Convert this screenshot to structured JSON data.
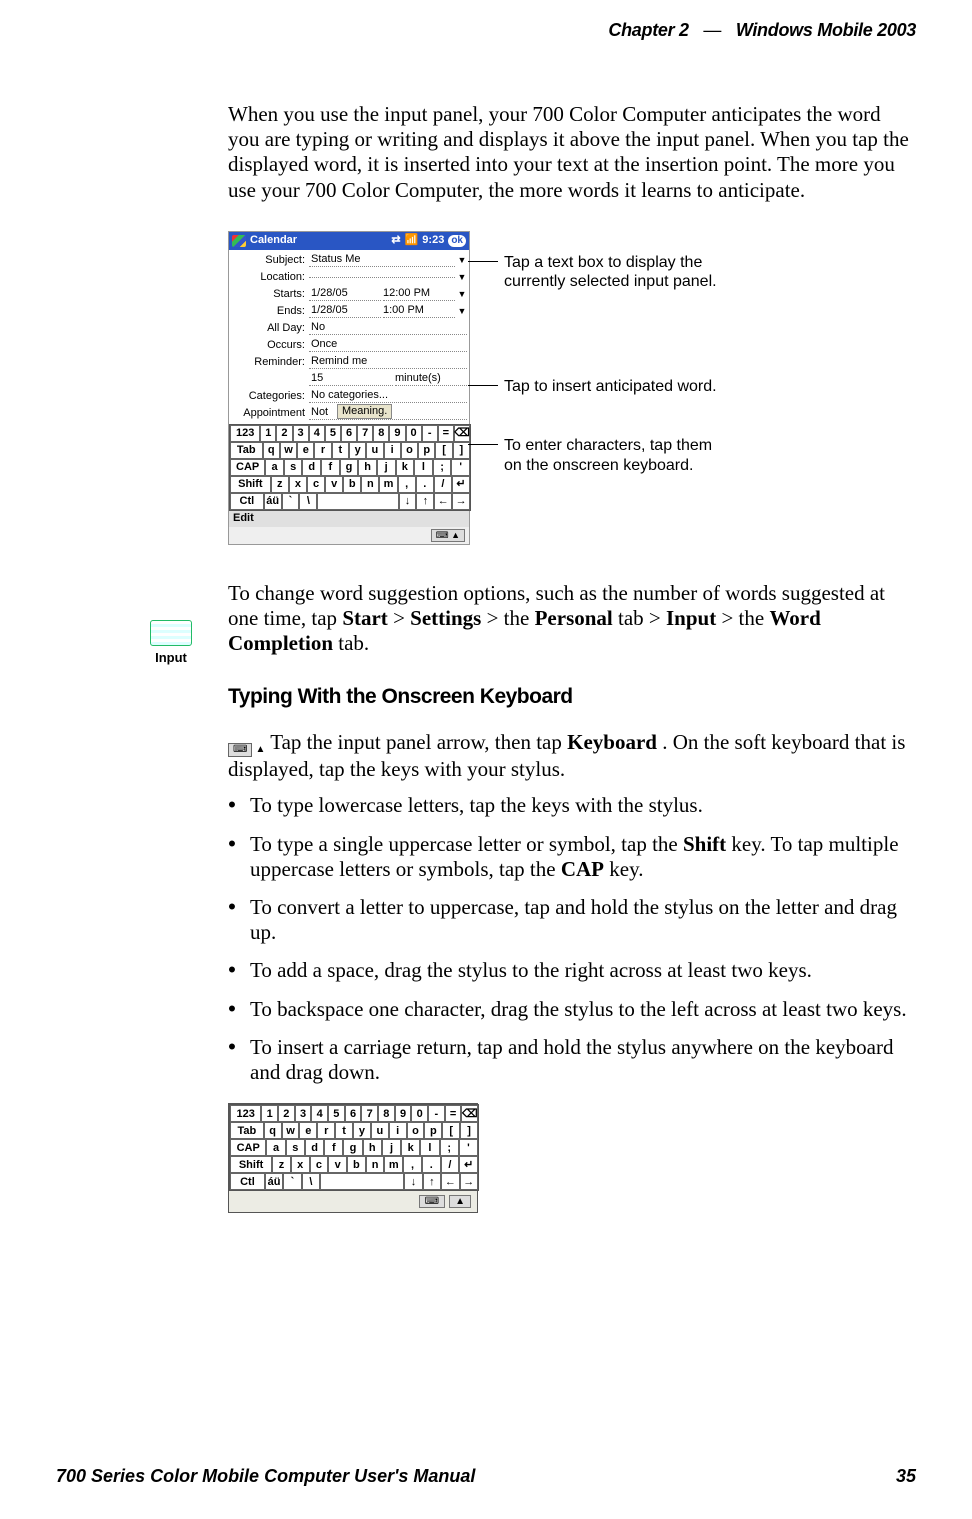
{
  "header": {
    "chapter": "Chapter 2",
    "dash": "—",
    "product": "Windows Mobile 2003"
  },
  "intro_para": "When you use the input panel, your 700 Color Computer anticipates the word you are typing or writing and displays it above the input panel. When you tap the displayed word, it is inserted into your text at the insertion point. The more you use your 700 Color Computer, the more words it learns to anticipate.",
  "shot": {
    "title": "Calendar",
    "time": "9:23",
    "ok": "ok",
    "rows": {
      "subject_lbl": "Subject:",
      "subject_val": "Status Me",
      "location_lbl": "Location:",
      "location_val": "",
      "starts_lbl": "Starts:",
      "starts_d": "1/28/05",
      "starts_t": "12:00 PM",
      "ends_lbl": "Ends:",
      "ends_d": "1/28/05",
      "ends_t": "1:00 PM",
      "allday_lbl": "All Day:",
      "allday_val": "No",
      "occurs_lbl": "Occurs:",
      "occurs_val": "Once",
      "reminder_lbl": "Reminder:",
      "reminder_val": "Remind me",
      "reminder_n": "15",
      "reminder_u": "minute(s)",
      "categories_lbl": "Categories:",
      "categories_val": "No categories...",
      "appointment_lbl": "Appointment",
      "appointment_val": "Not",
      "suggest": "Meaning."
    },
    "edit": "Edit"
  },
  "kb": {
    "r1": [
      "123",
      "1",
      "2",
      "3",
      "4",
      "5",
      "6",
      "7",
      "8",
      "9",
      "0",
      "-",
      "=",
      "⌫"
    ],
    "r2": [
      "Tab",
      "q",
      "w",
      "e",
      "r",
      "t",
      "y",
      "u",
      "i",
      "o",
      "p",
      "[",
      "]"
    ],
    "r3": [
      "CAP",
      "a",
      "s",
      "d",
      "f",
      "g",
      "h",
      "j",
      "k",
      "l",
      ";",
      "'"
    ],
    "r4": [
      "Shift",
      "z",
      "x",
      "c",
      "v",
      "b",
      "n",
      "m",
      ",",
      ".",
      "/",
      "↵"
    ],
    "r5": [
      "Ctl",
      "áü",
      "`",
      "\\",
      "",
      "↓",
      "↑",
      "←",
      "→"
    ]
  },
  "callouts": {
    "c1": "Tap a text box to display the currently selected input panel.",
    "c2": "Tap to insert anticipated word.",
    "c3": "To enter characters, tap them on the onscreen keyboard."
  },
  "input_icon_label": "Input",
  "settings_para": {
    "pre": "To change word suggestion options, such as the number of words suggested at one time, tap ",
    "start": "Start",
    "gt1": " > ",
    "settings": "Settings",
    "gt2": " > the ",
    "personal": "Personal",
    "tabword1": " tab > ",
    "input": "Input",
    "gt3": " > the ",
    "wordcompletion": "Word Completion",
    "tail": " tab."
  },
  "section_title": "Typing With the Onscreen Keyboard",
  "typing_para": {
    "pre": "Tap the input panel arrow, then tap ",
    "kb": "Keyboard",
    "post": ". On the soft keyboard that is displayed, tap the keys with your stylus."
  },
  "bullets": {
    "b1": "To type lowercase letters, tap the keys with the stylus.",
    "b2a": "To type a single uppercase letter or symbol, tap the ",
    "b2_shift": "Shift",
    "b2b": " key. To tap multiple uppercase letters or symbols, tap the ",
    "b2_cap": "CAP",
    "b2c": " key.",
    "b3": "To convert a letter to uppercase, tap and hold the stylus on the letter and drag up.",
    "b4": "To add a space, drag the stylus to the right across at least two keys.",
    "b5": "To backspace one character, drag the stylus to the left across at least two keys.",
    "b6": "To insert a carriage return, tap and hold the stylus anywhere on the keyboard and drag down."
  },
  "footer": {
    "left": "700 Series Color Mobile Computer User's Manual",
    "right": "35"
  }
}
